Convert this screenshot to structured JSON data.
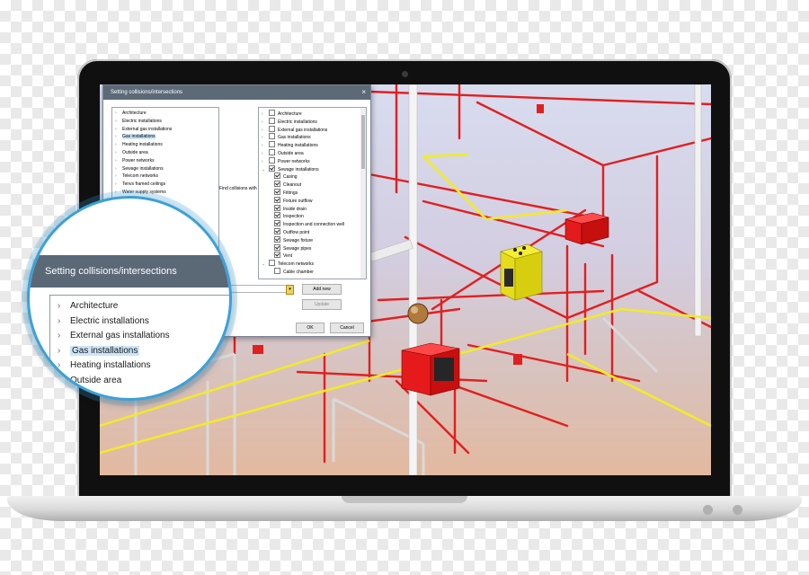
{
  "dialog": {
    "title": "Setting collisions/intersections",
    "close_glyph": "×",
    "left_items": [
      {
        "label": "Architecture",
        "selected": false
      },
      {
        "label": "Electric installations",
        "selected": false
      },
      {
        "label": "External gas installations",
        "selected": false
      },
      {
        "label": "Gas installations",
        "selected": true
      },
      {
        "label": "Heating installations",
        "selected": false
      },
      {
        "label": "Outside area",
        "selected": false
      },
      {
        "label": "Power networks",
        "selected": false
      },
      {
        "label": "Sewage installations",
        "selected": false
      },
      {
        "label": "Telecom networks",
        "selected": false
      },
      {
        "label": "Tenvs framed ceilings",
        "selected": false
      },
      {
        "label": "Water supply systems",
        "selected": false
      }
    ],
    "find_label": "Find collisions with",
    "right_items": [
      {
        "label": "Architecture",
        "checked": false,
        "expanded": false,
        "level": 0
      },
      {
        "label": "Electric installations",
        "checked": false,
        "expanded": false,
        "level": 0
      },
      {
        "label": "External gas installations",
        "checked": false,
        "expanded": false,
        "level": 0
      },
      {
        "label": "Gas installations",
        "checked": false,
        "expanded": false,
        "level": 0
      },
      {
        "label": "Heating installations",
        "checked": false,
        "expanded": false,
        "level": 0
      },
      {
        "label": "Outside area",
        "checked": false,
        "expanded": false,
        "level": 0
      },
      {
        "label": "Power networks",
        "checked": false,
        "expanded": false,
        "level": 0
      },
      {
        "label": "Sewage installations",
        "checked": true,
        "expanded": true,
        "level": 0
      },
      {
        "label": "Casing",
        "checked": true,
        "level": 1
      },
      {
        "label": "Cleanout",
        "checked": true,
        "level": 1
      },
      {
        "label": "Fittings",
        "checked": true,
        "level": 1
      },
      {
        "label": "Fixture outflow",
        "checked": true,
        "level": 1
      },
      {
        "label": "Inside drain",
        "checked": true,
        "level": 1
      },
      {
        "label": "Inspection",
        "checked": true,
        "level": 1
      },
      {
        "label": "Inspection and connection well",
        "checked": true,
        "level": 1
      },
      {
        "label": "Outflow point",
        "checked": true,
        "level": 1
      },
      {
        "label": "Sewage fixture",
        "checked": true,
        "level": 1
      },
      {
        "label": "Sewage pipes",
        "checked": true,
        "level": 1
      },
      {
        "label": "Vent",
        "checked": true,
        "level": 1
      },
      {
        "label": "Telecom networks",
        "checked": false,
        "expanded": true,
        "level": 0
      },
      {
        "label": "Cable chamber",
        "checked": false,
        "level": 1
      }
    ],
    "buttons": {
      "add_new": "Add new",
      "update": "Update",
      "ok": "OK",
      "cancel": "Cancel"
    }
  },
  "magnifier": {
    "title": "Setting collisions/intersections",
    "items": [
      {
        "label": "Architecture",
        "selected": false
      },
      {
        "label": "Electric installations",
        "selected": false
      },
      {
        "label": "External gas installations",
        "selected": false
      },
      {
        "label": "Gas installations",
        "selected": true
      },
      {
        "label": "Heating installations",
        "selected": false
      },
      {
        "label": "Outside area",
        "selected": false
      }
    ]
  },
  "colors": {
    "pipe_red": "#e02020",
    "pipe_yellow": "#f2ea2a",
    "pipe_white": "#eeeeee",
    "dialog_titlebar": "#5c6a78",
    "magnifier_ring": "#3ba1d9",
    "selection": "#cde4f7"
  }
}
